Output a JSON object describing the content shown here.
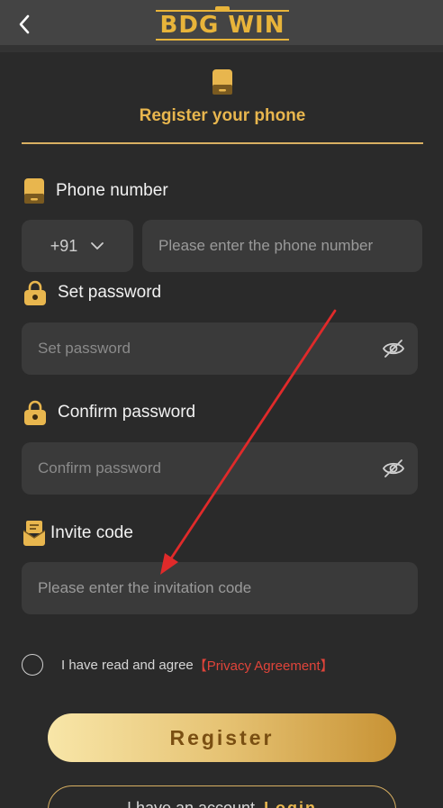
{
  "header": {
    "logo_text": "BDG WIN",
    "back_icon": "chevron-left-icon"
  },
  "tab": {
    "icon": "phone-icon",
    "title": "Register your phone"
  },
  "phone": {
    "label": "Phone number",
    "icon": "phone-icon",
    "country_code": "+91",
    "placeholder": "Please enter the phone number"
  },
  "password": {
    "label": "Set password",
    "icon": "lock-icon",
    "placeholder": "Set password"
  },
  "confirm": {
    "label": "Confirm password",
    "icon": "lock-icon",
    "placeholder": "Confirm password"
  },
  "invite": {
    "label": "Invite code",
    "icon": "invite-icon",
    "placeholder": "Please enter the invitation code"
  },
  "agreement": {
    "text": "I have read and agree",
    "link": "【Privacy Agreement】"
  },
  "buttons": {
    "register": "Register",
    "login_prefix": "I have an account",
    "login": "Login"
  },
  "colors": {
    "background": "#2a2a2a",
    "accent_gold": "#e8b64e",
    "field_bg": "#3a3a3a",
    "link_red": "#e0443a",
    "annotation_arrow": "#e02a2a"
  }
}
